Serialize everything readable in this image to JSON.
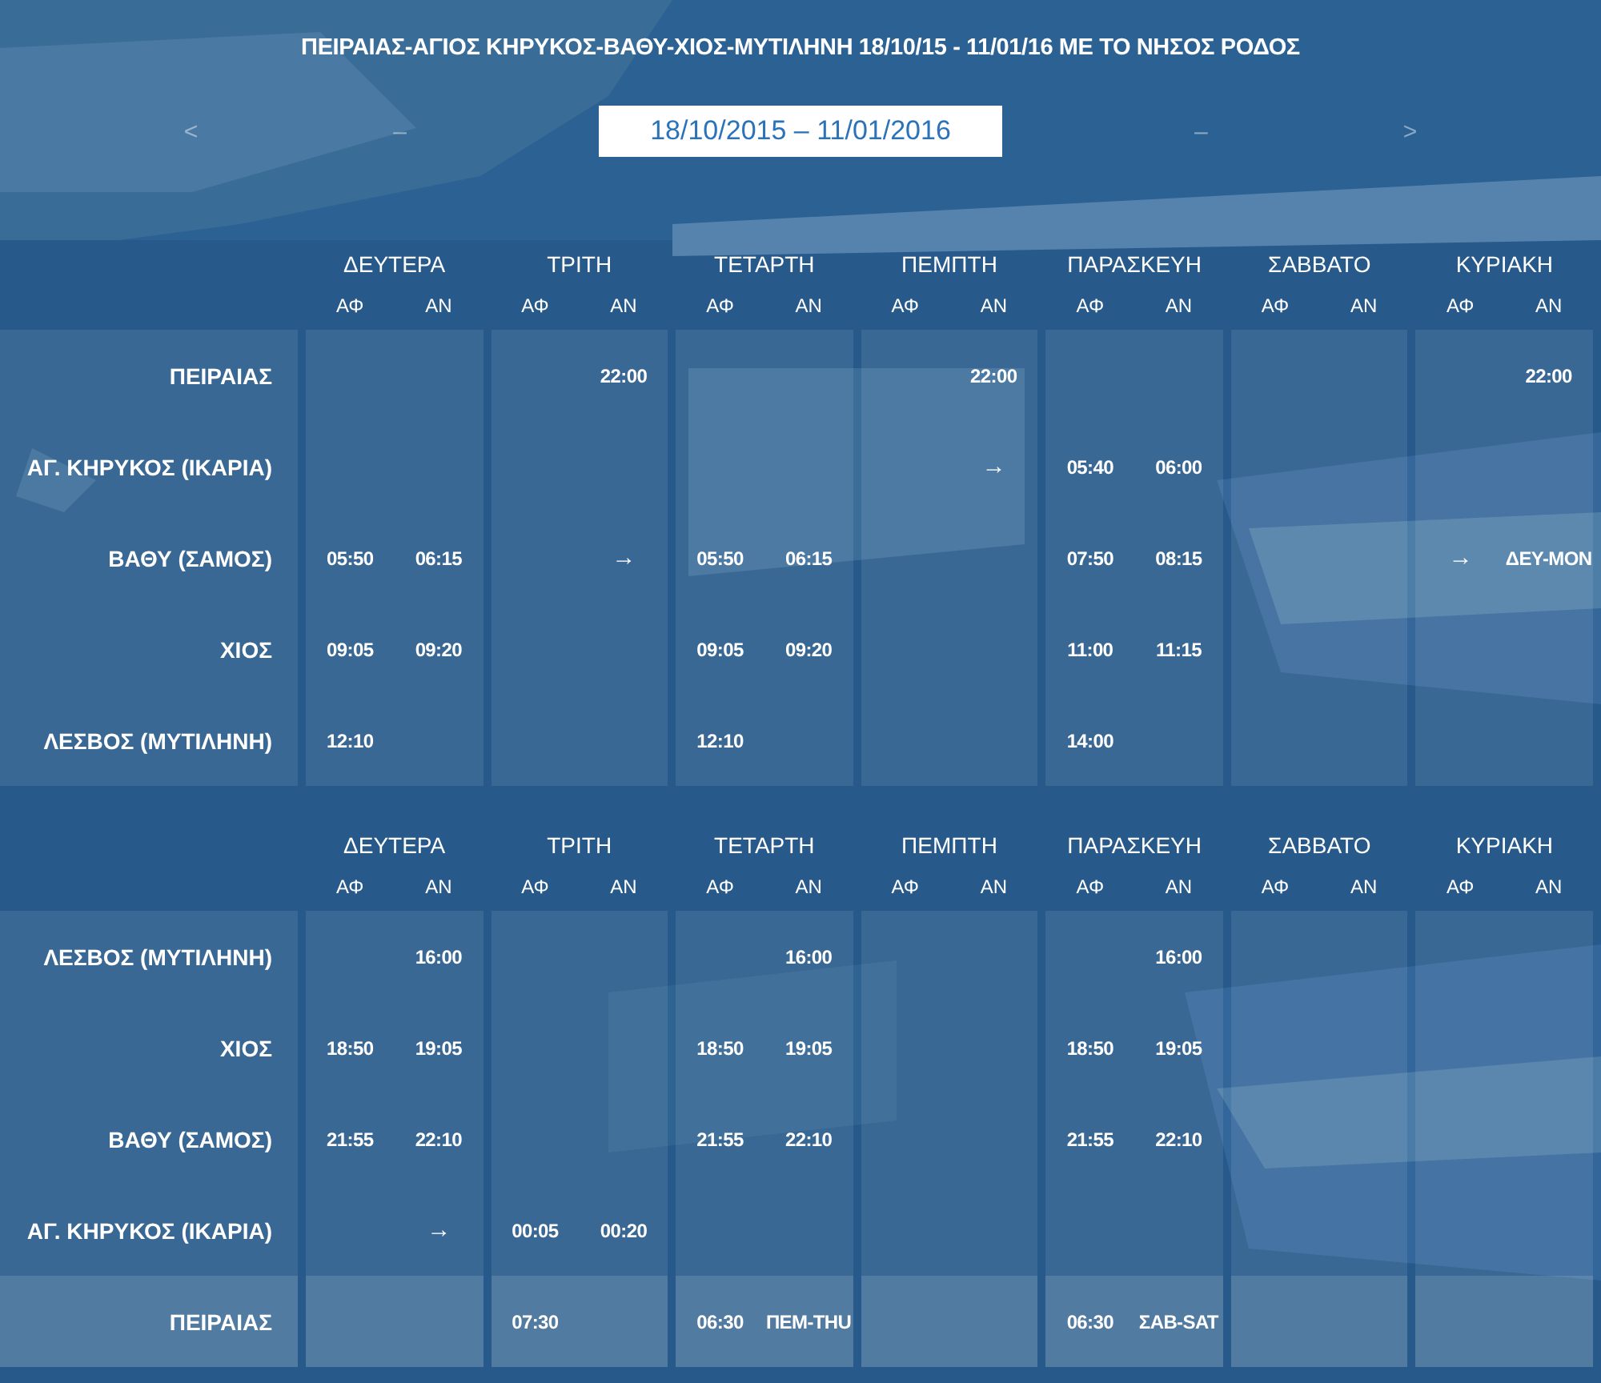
{
  "title": "ΠΕΙΡΑΙΑΣ-ΑΓΙΟΣ ΚΗΡΥΚΟΣ-ΒΑΘΥ-ΧΙΟΣ-ΜΥΤΙΛΗΝΗ 18/10/15 - 11/01/16 ΜΕ ΤΟ ΝΗΣΟΣ ΡΟΔΟΣ",
  "date_nav": {
    "prev": "<",
    "left_dash": "–",
    "range": "18/10/2015 – 11/01/2016",
    "right_dash": "–",
    "next": ">"
  },
  "sections": [
    {
      "days": [
        {
          "name": "ΔΕΥΤΕΡΑ",
          "dep": "ΑΦ",
          "arr": "ΑΝ"
        },
        {
          "name": "ΤΡΙΤΗ",
          "dep": "ΑΦ",
          "arr": "ΑΝ"
        },
        {
          "name": "ΤΕΤΑΡΤΗ",
          "dep": "ΑΦ",
          "arr": "ΑΝ"
        },
        {
          "name": "ΠΕΜΠΤΗ",
          "dep": "ΑΦ",
          "arr": "ΑΝ"
        },
        {
          "name": "ΠΑΡΑΣΚΕΥΗ",
          "dep": "ΑΦ",
          "arr": "ΑΝ"
        },
        {
          "name": "ΣΑΒΒΑΤΟ",
          "dep": "ΑΦ",
          "arr": "ΑΝ"
        },
        {
          "name": "ΚΥΡΙΑΚΗ",
          "dep": "ΑΦ",
          "arr": "ΑΝ"
        }
      ],
      "rows": [
        {
          "port": "ΠΕΙΡΑΙΑΣ",
          "highlighted": false,
          "cells": [
            null,
            null,
            null,
            "22:00",
            null,
            null,
            null,
            "22:00",
            null,
            null,
            null,
            null,
            null,
            "22:00"
          ]
        },
        {
          "port": "ΑΓ. ΚΗΡΥΚΟΣ (ΙΚΑΡΙΑ)",
          "highlighted": false,
          "cells": [
            null,
            null,
            null,
            null,
            null,
            null,
            null,
            "→",
            "05:40",
            "06:00",
            null,
            null,
            null,
            null
          ]
        },
        {
          "port": "ΒΑΘΥ (ΣΑΜΟΣ)",
          "highlighted": false,
          "cells": [
            "05:50",
            "06:15",
            null,
            "→",
            "05:50",
            "06:15",
            null,
            null,
            "07:50",
            "08:15",
            null,
            null,
            "→",
            "ΔΕΥ-MON"
          ]
        },
        {
          "port": "ΧΙΟΣ",
          "highlighted": false,
          "cells": [
            "09:05",
            "09:20",
            null,
            null,
            "09:05",
            "09:20",
            null,
            null,
            "11:00",
            "11:15",
            null,
            null,
            null,
            null
          ]
        },
        {
          "port": "ΛΕΣΒΟΣ (ΜΥΤΙΛΗΝΗ)",
          "highlighted": false,
          "cells": [
            "12:10",
            null,
            null,
            null,
            "12:10",
            null,
            null,
            null,
            "14:00",
            null,
            null,
            null,
            null,
            null
          ]
        }
      ]
    },
    {
      "days": [
        {
          "name": "ΔΕΥΤΕΡΑ",
          "dep": "ΑΦ",
          "arr": "ΑΝ"
        },
        {
          "name": "ΤΡΙΤΗ",
          "dep": "ΑΦ",
          "arr": "ΑΝ"
        },
        {
          "name": "ΤΕΤΑΡΤΗ",
          "dep": "ΑΦ",
          "arr": "ΑΝ"
        },
        {
          "name": "ΠΕΜΠΤΗ",
          "dep": "ΑΦ",
          "arr": "ΑΝ"
        },
        {
          "name": "ΠΑΡΑΣΚΕΥΗ",
          "dep": "ΑΦ",
          "arr": "ΑΝ"
        },
        {
          "name": "ΣΑΒΒΑΤΟ",
          "dep": "ΑΦ",
          "arr": "ΑΝ"
        },
        {
          "name": "ΚΥΡΙΑΚΗ",
          "dep": "ΑΦ",
          "arr": "ΑΝ"
        }
      ],
      "rows": [
        {
          "port": "ΛΕΣΒΟΣ (ΜΥΤΙΛΗΝΗ)",
          "highlighted": false,
          "cells": [
            null,
            "16:00",
            null,
            null,
            null,
            "16:00",
            null,
            null,
            null,
            "16:00",
            null,
            null,
            null,
            null
          ]
        },
        {
          "port": "ΧΙΟΣ",
          "highlighted": false,
          "cells": [
            "18:50",
            "19:05",
            null,
            null,
            "18:50",
            "19:05",
            null,
            null,
            "18:50",
            "19:05",
            null,
            null,
            null,
            null
          ]
        },
        {
          "port": "ΒΑΘΥ (ΣΑΜΟΣ)",
          "highlighted": false,
          "cells": [
            "21:55",
            "22:10",
            null,
            null,
            "21:55",
            "22:10",
            null,
            null,
            "21:55",
            "22:10",
            null,
            null,
            null,
            null
          ]
        },
        {
          "port": "ΑΓ. ΚΗΡΥΚΟΣ (ΙΚΑΡΙΑ)",
          "highlighted": false,
          "cells": [
            null,
            "→",
            "00:05",
            "00:20",
            null,
            null,
            null,
            null,
            null,
            null,
            null,
            null,
            null,
            null
          ]
        },
        {
          "port": "ΠΕΙΡΑΙΑΣ",
          "highlighted": true,
          "cells": [
            null,
            null,
            "07:30",
            null,
            "06:30",
            "ΠΕΜ-THU",
            null,
            null,
            "06:30",
            "ΣΑΒ-SAT",
            null,
            null,
            null,
            null
          ]
        }
      ]
    }
  ]
}
